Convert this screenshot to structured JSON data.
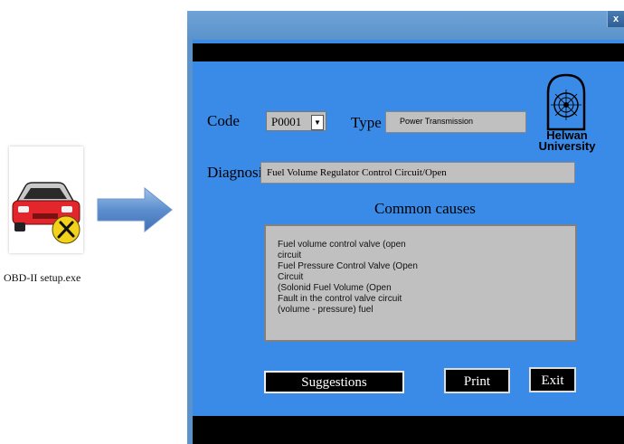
{
  "desktop": {
    "icon_caption": "OBD-II setup.exe",
    "icon_name": "car-repair-icon",
    "arrow_icon": "right-arrow-icon"
  },
  "window": {
    "close_label": "x",
    "code_label": "Code",
    "code_value": "P0001",
    "type_label": "Type",
    "type_value": "Power Transmission",
    "diagnosis_label": "Diagnosis",
    "diagnosis_value": "Fuel Volume Regulator Control Circuit/Open",
    "common_causes_title": "Common causes",
    "causes": [
      "Fuel volume control valve (open",
      "circuit",
      "Fuel Pressure Control Valve (Open",
      "Circuit",
      "(Solonid Fuel Volume (Open",
      "Fault in the control valve circuit",
      "(volume - pressure) fuel"
    ],
    "logo_text_1": "Helwan",
    "logo_text_2": "University",
    "buttons": {
      "suggestions": "Suggestions",
      "print": "Print",
      "exit": "Exit"
    }
  },
  "colors": {
    "window_bg": "#3a8be8",
    "field_bg": "#c0c0c0",
    "button_bg": "#000000"
  }
}
